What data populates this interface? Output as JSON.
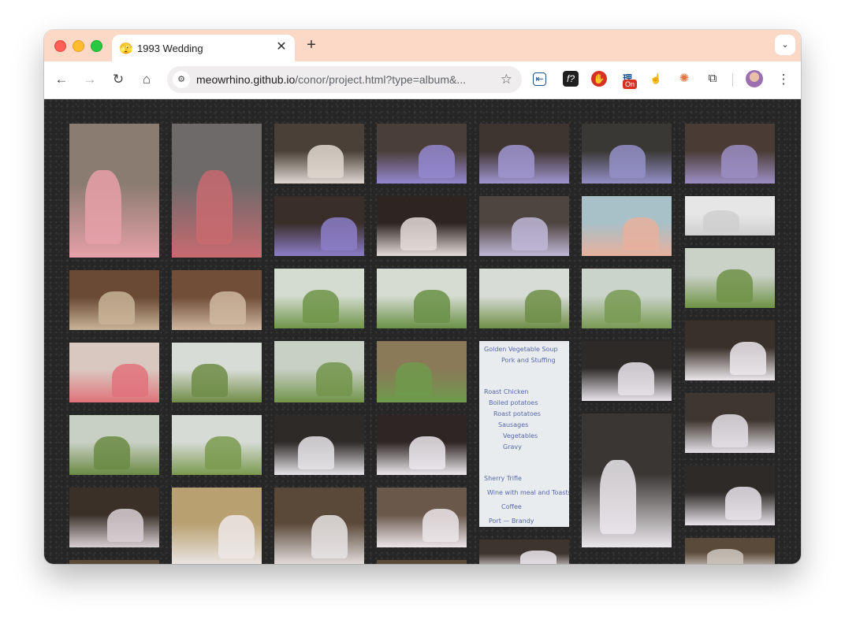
{
  "tab": {
    "title": "1993 Wedding",
    "favicon": "🫣"
  },
  "address": {
    "host": "meowrhino.github.io",
    "path": "/conor/project.html?type=album&..."
  },
  "extensions": [
    {
      "name": "reader-icon",
      "glyph": "⇤"
    },
    {
      "name": "font-icon",
      "glyph": "f?"
    },
    {
      "name": "stop-hand-icon",
      "glyph": "✋"
    },
    {
      "name": "translate-icon",
      "glyph": "理",
      "badge": "On"
    },
    {
      "name": "hand-icon",
      "glyph": "☝"
    },
    {
      "name": "sparkle-icon",
      "glyph": "✺"
    },
    {
      "name": "puzzle-icon",
      "glyph": "⧉"
    }
  ],
  "columns": [
    [
      {
        "h": 170,
        "c1": "#8a7c70",
        "c2": "#e6a0a8"
      },
      {
        "h": 76,
        "c1": "#6a4a34",
        "c2": "#c8b498"
      },
      {
        "h": 76,
        "c1": "#d9c8c0",
        "c2": "#e0727a"
      },
      {
        "h": 76,
        "c1": "#c8d0c4",
        "c2": "#6a8a44"
      },
      {
        "h": 76,
        "c1": "#3a3028",
        "c2": "#d8d0d4"
      },
      {
        "h": 20,
        "c1": "#5a4a3a",
        "c2": "#8a7a66"
      }
    ],
    [
      {
        "h": 170,
        "c1": "#6e6a6a",
        "c2": "#c86a70"
      },
      {
        "h": 76,
        "c1": "#704e38",
        "c2": "#d0b8a0"
      },
      {
        "h": 76,
        "c1": "#d8dcd6",
        "c2": "#6f8c46"
      },
      {
        "h": 76,
        "c1": "#d6dbd6",
        "c2": "#7a9a4e"
      },
      {
        "h": 100,
        "c1": "#b8a070",
        "c2": "#ece8e8"
      }
    ],
    [
      {
        "h": 76,
        "c1": "#4a4038",
        "c2": "#e0d8d0"
      },
      {
        "h": 76,
        "c1": "#3a2e2a",
        "c2": "#8c7ec8"
      },
      {
        "h": 76,
        "c1": "#d4dcd0",
        "c2": "#6e9448"
      },
      {
        "h": 78,
        "c1": "#c8d0c4",
        "c2": "#72944a"
      },
      {
        "h": 76,
        "c1": "#2e2a28",
        "c2": "#e6e4e8"
      },
      {
        "h": 100,
        "c1": "#5a4838",
        "c2": "#e8e4e4"
      }
    ],
    [
      {
        "h": 76,
        "c1": "#4a3e38",
        "c2": "#9488d0"
      },
      {
        "h": 76,
        "c1": "#2e2422",
        "c2": "#e4dcd8"
      },
      {
        "h": 76,
        "c1": "#d6dcd2",
        "c2": "#6a9046"
      },
      {
        "h": 78,
        "c1": "#8a7a58",
        "c2": "#6e9a4c"
      },
      {
        "h": 76,
        "c1": "#2e2624",
        "c2": "#ece8ec"
      },
      {
        "h": 76,
        "c1": "#6a584a",
        "c2": "#ece6ea"
      },
      {
        "h": 20,
        "c1": "#5a4a3a",
        "c2": "#8a7a66"
      }
    ],
    [
      {
        "h": 76,
        "c1": "#3e3430",
        "c2": "#a096d0"
      },
      {
        "h": 76,
        "c1": "#4e4440",
        "c2": "#c0b8d8"
      },
      {
        "h": 76,
        "c1": "#d8dcd6",
        "c2": "#6e8e46"
      },
      {
        "note": true,
        "h": 236
      },
      {
        "h": 40,
        "c1": "#3e342e",
        "c2": "#ece8ec"
      }
    ],
    [
      {
        "h": 76,
        "c1": "#3a3834",
        "c2": "#9490c8"
      },
      {
        "h": 76,
        "c1": "#a8c0c8",
        "c2": "#e8b09c"
      },
      {
        "h": 76,
        "c1": "#cad4ca",
        "c2": "#789a52"
      },
      {
        "h": 76,
        "c1": "#2e2a28",
        "c2": "#e8e4ea"
      },
      {
        "h": 170,
        "c1": "#3a3634",
        "c2": "#ebe8ec"
      }
    ],
    [
      {
        "h": 76,
        "c1": "#4a3c34",
        "c2": "#9c8ec4"
      },
      {
        "h": 50,
        "c1": "#e6e6e6",
        "c2": "#cfcfcf"
      },
      {
        "h": 76,
        "c1": "#cad2c8",
        "c2": "#6e9246"
      },
      {
        "h": 76,
        "c1": "#3a302a",
        "c2": "#ece8ec"
      },
      {
        "h": 76,
        "c1": "#3e3630",
        "c2": "#e4e0e6"
      },
      {
        "h": 76,
        "c1": "#2e2a28",
        "c2": "#e8e4ea"
      },
      {
        "h": 40,
        "c1": "#5a4a3a",
        "c2": "#cfc8c0"
      }
    ]
  ],
  "note_lines": [
    "Golden Vegetable Soup",
    "Pork and Stuffing",
    "Roast Chicken",
    "Boiled potatoes",
    "Roast potatoes",
    "Sausages",
    "Vegetables",
    "Gravy",
    "Sherry Trifle",
    "Wine with meal and Toasts",
    "Coffee",
    "Port — Brandy"
  ]
}
